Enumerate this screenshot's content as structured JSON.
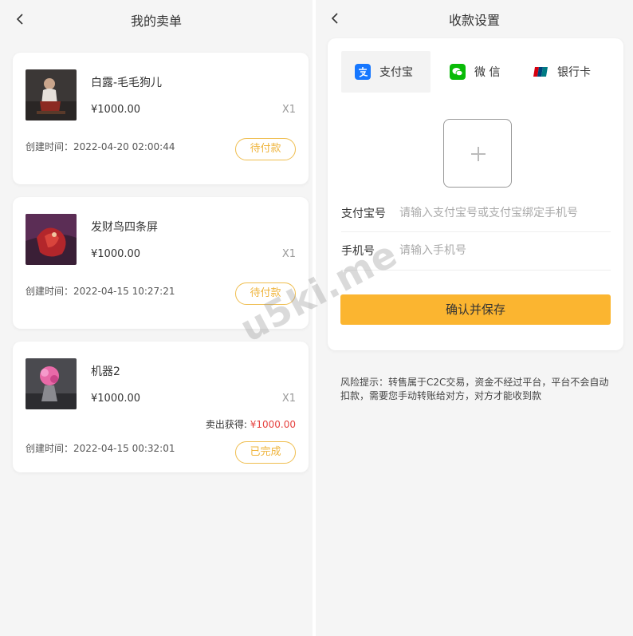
{
  "left": {
    "title": "我的卖单",
    "orders": [
      {
        "name": "白露-毛毛狗儿",
        "price": "¥1000.00",
        "qty": "X1",
        "time_label": "创建时间：",
        "time": "2022-04-20 02:00:44",
        "status": "待付款",
        "thumb_icon": "artwork-thumbnail-icon"
      },
      {
        "name": "发财鸟四条屏",
        "price": "¥1000.00",
        "qty": "X1",
        "time_label": "创建时间：",
        "time": "2022-04-15 10:27:21",
        "status": "待付款",
        "thumb_icon": "artwork-thumbnail-icon"
      },
      {
        "name": "机器2",
        "price": "¥1000.00",
        "qty": "X1",
        "earn_label": "卖出获得: ",
        "earn_amount": "¥1000.00",
        "time_label": "创建时间：",
        "time": "2022-04-15 00:32:01",
        "status": "已完成",
        "thumb_icon": "artwork-thumbnail-icon"
      }
    ]
  },
  "right": {
    "title": "收款设置",
    "tabs": [
      {
        "label": "支付宝",
        "icon": "alipay-icon",
        "color": "#1677ff"
      },
      {
        "label": "微 信",
        "icon": "wechat-icon",
        "color": "#09bb07"
      },
      {
        "label": "银行卡",
        "icon": "unionpay-icon",
        "color": "#d7000f"
      }
    ],
    "fields": [
      {
        "label": "支付宝号",
        "placeholder": "请输入支付宝号或支付宝绑定手机号",
        "value": ""
      },
      {
        "label": "手机号",
        "placeholder": "请输入手机号",
        "value": ""
      }
    ],
    "confirm_label": "确认并保存",
    "risk_text": "风险提示：转售属于C2C交易，资金不经过平台，平台不会自动扣款，需要您手动转账给对方，对方才能收到款"
  },
  "watermark": "u5ki.me",
  "colors": {
    "accent": "#fbb530",
    "status_border": "#efbd4e",
    "earn_amount": "#e64340"
  }
}
